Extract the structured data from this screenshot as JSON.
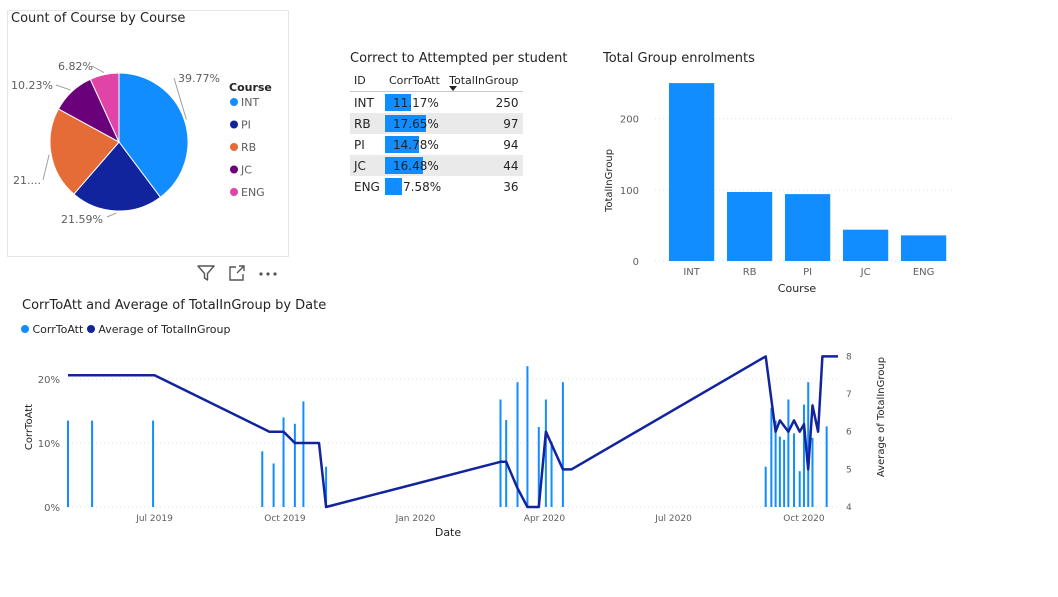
{
  "pie_card": {
    "title": "Count of Course by Course",
    "legend_title": "Course"
  },
  "matrix": {
    "title": "Correct to Attempted per student",
    "headers": [
      "ID",
      "CorrToAtt",
      "TotalInGroup"
    ]
  },
  "bar_card": {
    "title": "Total Group enrolments"
  },
  "combo_card": {
    "title": "CorrToAtt and Average of TotalInGroup by Date",
    "legend": [
      "CorrToAtt",
      "Average of TotalInGroup"
    ]
  },
  "icons": [
    "filter-icon",
    "focus-mode-icon",
    "more-options-icon"
  ],
  "colors": {
    "accent": "#118dff",
    "dark_blue": "#12239e",
    "orange": "#e66c37",
    "purple": "#6b007b",
    "pink": "#e044a7"
  },
  "chart_data": [
    {
      "type": "pie",
      "title": "Count of Course by Course",
      "legend_title": "Course",
      "legend_position": "right",
      "categories": [
        "INT",
        "PI",
        "RB",
        "JC",
        "ENG"
      ],
      "values": [
        39.77,
        21.59,
        21.59,
        10.23,
        6.82
      ],
      "labels": [
        "39.77%",
        "21.59%",
        "21....",
        "10.23%",
        "6.82%"
      ],
      "colors": [
        "#118dff",
        "#12239e",
        "#e66c37",
        "#6b007b",
        "#e044a7"
      ]
    },
    {
      "type": "table",
      "title": "Correct to Attempted per student",
      "columns": [
        "ID",
        "CorrToAtt",
        "TotalInGroup"
      ],
      "sort": "TotalInGroup descending",
      "rows": [
        {
          "id": "INT",
          "corr": 11.17,
          "corr_label": "11.17%",
          "total": "250"
        },
        {
          "id": "RB",
          "corr": 17.65,
          "corr_label": "17.65%",
          "total": "97"
        },
        {
          "id": "PI",
          "corr": 14.78,
          "corr_label": "14.78%",
          "total": "94"
        },
        {
          "id": "JC",
          "corr": 16.48,
          "corr_label": "16.48%",
          "total": "44"
        },
        {
          "id": "ENG",
          "corr": 7.58,
          "corr_label": "7.58%",
          "total": "36"
        }
      ]
    },
    {
      "type": "bar",
      "title": "Total Group enrolments",
      "xlabel": "Course",
      "ylabel": "TotalInGroup",
      "categories": [
        "INT",
        "RB",
        "PI",
        "JC",
        "ENG"
      ],
      "values": [
        250,
        97,
        94,
        44,
        36
      ],
      "ylim": [
        0,
        260
      ],
      "yticks": [
        "0",
        "100",
        "200"
      ],
      "grid": true
    },
    {
      "type": "bar",
      "combo": "bar+line",
      "title": "CorrToAtt and Average of TotalInGroup by Date",
      "xlabel": "Date",
      "ylabel": "CorrToAtt",
      "y2label": "Average of TotalInGroup",
      "xlim": [
        "2019-05-01",
        "2020-10-25"
      ],
      "xticks": [
        {
          "date": "2019-07-01",
          "label": "Jul 2019"
        },
        {
          "date": "2019-10-01",
          "label": "Oct 2019"
        },
        {
          "date": "2020-01-01",
          "label": "Jan 2020"
        },
        {
          "date": "2020-04-01",
          "label": "Apr 2020"
        },
        {
          "date": "2020-07-01",
          "label": "Jul 2020"
        },
        {
          "date": "2020-10-01",
          "label": "Oct 2020"
        }
      ],
      "ylim": [
        0,
        25
      ],
      "yticks": [
        "0%",
        "10%",
        "20%"
      ],
      "y2lim": [
        4,
        8.25
      ],
      "y2ticks": [
        "4",
        "5",
        "6",
        "7",
        "8"
      ],
      "legend_position": "top-left",
      "series": [
        {
          "name": "CorrToAtt",
          "type": "bar",
          "points": [
            {
              "x": "2019-05-01",
              "y": 13.5
            },
            {
              "x": "2019-05-18",
              "y": 13.5
            },
            {
              "x": "2019-06-30",
              "y": 13.5
            },
            {
              "x": "2019-09-15",
              "y": 8.7
            },
            {
              "x": "2019-09-23",
              "y": 6.8
            },
            {
              "x": "2019-09-30",
              "y": 14.0
            },
            {
              "x": "2019-10-08",
              "y": 13.0
            },
            {
              "x": "2019-10-14",
              "y": 16.5
            },
            {
              "x": "2019-10-30",
              "y": 6.3
            },
            {
              "x": "2020-03-01",
              "y": 16.8
            },
            {
              "x": "2020-03-05",
              "y": 13.6
            },
            {
              "x": "2020-03-13",
              "y": 19.5
            },
            {
              "x": "2020-03-20",
              "y": 22.0
            },
            {
              "x": "2020-03-28",
              "y": 12.5
            },
            {
              "x": "2020-04-02",
              "y": 16.8
            },
            {
              "x": "2020-04-06",
              "y": 10.2
            },
            {
              "x": "2020-04-14",
              "y": 19.5
            },
            {
              "x": "2020-09-04",
              "y": 6.3
            },
            {
              "x": "2020-09-08",
              "y": 15.5
            },
            {
              "x": "2020-09-11",
              "y": 13.5
            },
            {
              "x": "2020-09-14",
              "y": 11.0
            },
            {
              "x": "2020-09-17",
              "y": 10.5
            },
            {
              "x": "2020-09-20",
              "y": 16.8
            },
            {
              "x": "2020-09-24",
              "y": 11.5
            },
            {
              "x": "2020-09-28",
              "y": 5.6
            },
            {
              "x": "2020-10-01",
              "y": 16.0
            },
            {
              "x": "2020-10-04",
              "y": 19.5
            },
            {
              "x": "2020-10-07",
              "y": 10.8
            },
            {
              "x": "2020-10-17",
              "y": 12.6
            }
          ]
        },
        {
          "name": "Average of TotalInGroup",
          "type": "line",
          "points": [
            {
              "x": "2019-05-01",
              "y": 7.5
            },
            {
              "x": "2019-07-01",
              "y": 7.5
            },
            {
              "x": "2019-09-20",
              "y": 6.0
            },
            {
              "x": "2019-09-30",
              "y": 6.0
            },
            {
              "x": "2019-10-08",
              "y": 5.7
            },
            {
              "x": "2019-10-25",
              "y": 5.7
            },
            {
              "x": "2019-10-30",
              "y": 4.0
            },
            {
              "x": "2020-03-01",
              "y": 5.2
            },
            {
              "x": "2020-03-05",
              "y": 5.2
            },
            {
              "x": "2020-03-13",
              "y": 4.5
            },
            {
              "x": "2020-03-20",
              "y": 4.0
            },
            {
              "x": "2020-03-28",
              "y": 4.0
            },
            {
              "x": "2020-04-02",
              "y": 6.0
            },
            {
              "x": "2020-04-14",
              "y": 5.0
            },
            {
              "x": "2020-04-20",
              "y": 5.0
            },
            {
              "x": "2020-09-04",
              "y": 8.0
            },
            {
              "x": "2020-09-11",
              "y": 6.0
            },
            {
              "x": "2020-09-14",
              "y": 6.3
            },
            {
              "x": "2020-09-20",
              "y": 6.0
            },
            {
              "x": "2020-09-24",
              "y": 6.3
            },
            {
              "x": "2020-09-28",
              "y": 6.0
            },
            {
              "x": "2020-10-01",
              "y": 6.2
            },
            {
              "x": "2020-10-04",
              "y": 5.0
            },
            {
              "x": "2020-10-07",
              "y": 6.7
            },
            {
              "x": "2020-10-11",
              "y": 6.0
            },
            {
              "x": "2020-10-14",
              "y": 8.0
            },
            {
              "x": "2020-10-25",
              "y": 8.0
            }
          ]
        }
      ]
    }
  ]
}
